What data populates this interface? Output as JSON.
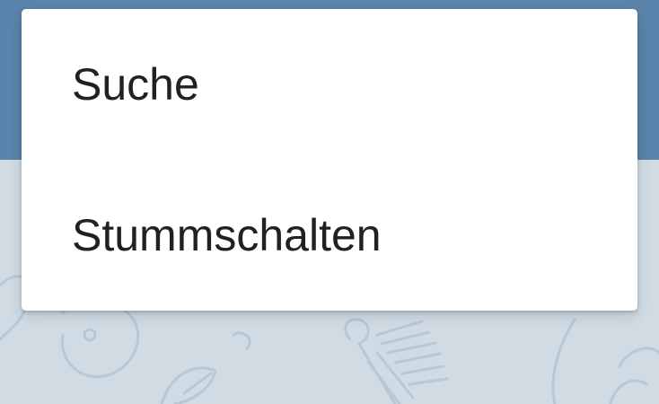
{
  "menu": {
    "items": [
      {
        "label": "Suche"
      },
      {
        "label": "Stummschalten"
      }
    ]
  },
  "colors": {
    "toolbar": "#5a84ab",
    "chat_background": "#d0dbe4",
    "menu_background": "#ffffff",
    "menu_text": "#212121"
  }
}
